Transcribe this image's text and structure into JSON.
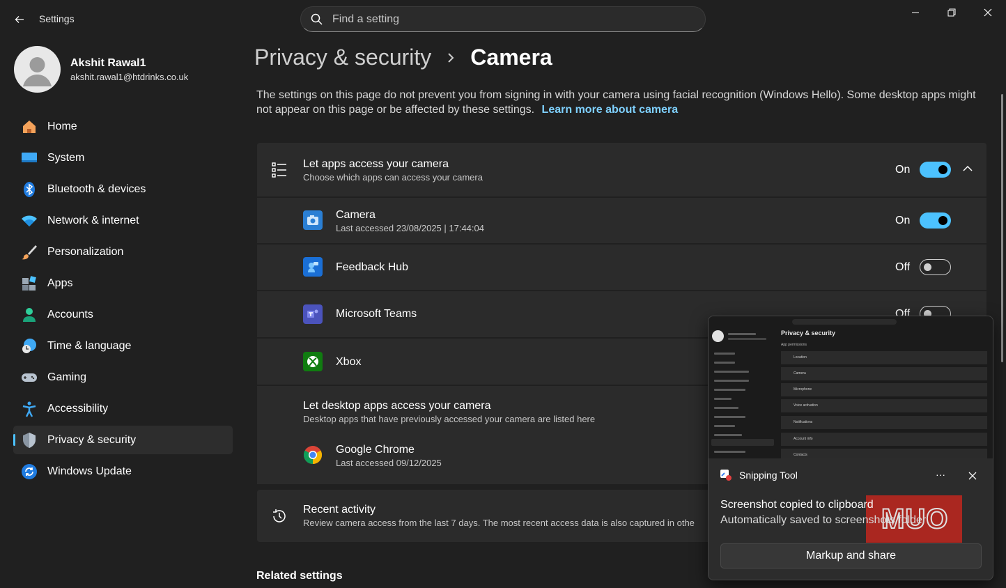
{
  "window": {
    "app_title": "Settings",
    "search_placeholder": "Find a setting"
  },
  "profile": {
    "name": "Akshit Rawal1",
    "email": "akshit.rawal1@htdrinks.co.uk"
  },
  "sidebar": {
    "items": [
      {
        "label": "Home",
        "icon": "home-icon"
      },
      {
        "label": "System",
        "icon": "monitor-icon"
      },
      {
        "label": "Bluetooth & devices",
        "icon": "bluetooth-icon"
      },
      {
        "label": "Network & internet",
        "icon": "wifi-icon"
      },
      {
        "label": "Personalization",
        "icon": "brush-icon"
      },
      {
        "label": "Apps",
        "icon": "apps-icon"
      },
      {
        "label": "Accounts",
        "icon": "person-icon"
      },
      {
        "label": "Time & language",
        "icon": "globe-clock-icon"
      },
      {
        "label": "Gaming",
        "icon": "gamepad-icon"
      },
      {
        "label": "Accessibility",
        "icon": "accessibility-icon"
      },
      {
        "label": "Privacy & security",
        "icon": "shield-icon",
        "active": true
      },
      {
        "label": "Windows Update",
        "icon": "update-icon"
      }
    ]
  },
  "breadcrumb": {
    "parent": "Privacy & security",
    "current": "Camera"
  },
  "description": {
    "text": "The settings on this page do not prevent you from signing in with your camera using facial recognition (Windows Hello). Some desktop apps might not appear on this page or be affected by these settings.",
    "link": "Learn more about camera"
  },
  "main_setting": {
    "title": "Let apps access your camera",
    "subtitle": "Choose which apps can access your camera",
    "state": "On"
  },
  "apps": [
    {
      "name": "Camera",
      "detail": "Last accessed 23/08/2025  |  17:44:04",
      "state": "On",
      "icon": "camera-app-icon"
    },
    {
      "name": "Feedback Hub",
      "detail": "",
      "state": "Off",
      "icon": "feedback-hub-icon"
    },
    {
      "name": "Microsoft Teams",
      "detail": "",
      "state": "Off",
      "icon": "teams-icon"
    },
    {
      "name": "Xbox",
      "detail": "",
      "state": "",
      "icon": "xbox-icon"
    }
  ],
  "desktop_apps": {
    "title": "Let desktop apps access your camera",
    "subtitle": "Desktop apps that have previously accessed your camera are listed here",
    "items": [
      {
        "name": "Google Chrome",
        "detail": "Last accessed 09/12/2025",
        "icon": "chrome-icon"
      }
    ]
  },
  "recent_activity": {
    "title": "Recent activity",
    "subtitle": "Review camera access from the last 7 days. The most recent access data is also captured in othe"
  },
  "related_settings": "Related settings",
  "snipping_tool": {
    "app_name": "Snipping Tool",
    "more": "···",
    "message": "Screenshot copied to clipboard",
    "detail": "Automatically saved to screenshots folder",
    "button": "Markup and share",
    "watermark": "MUO",
    "preview": {
      "title": "Privacy & security",
      "subtitle": "App permissions",
      "rows": [
        "Location",
        "Camera",
        "Microphone",
        "Voice activation",
        "Notifications",
        "Account info",
        "Contacts"
      ]
    }
  },
  "colors": {
    "accent": "#4cc2ff",
    "background": "#202020",
    "card": "#2b2b2b",
    "watermark": "#c0271f"
  }
}
